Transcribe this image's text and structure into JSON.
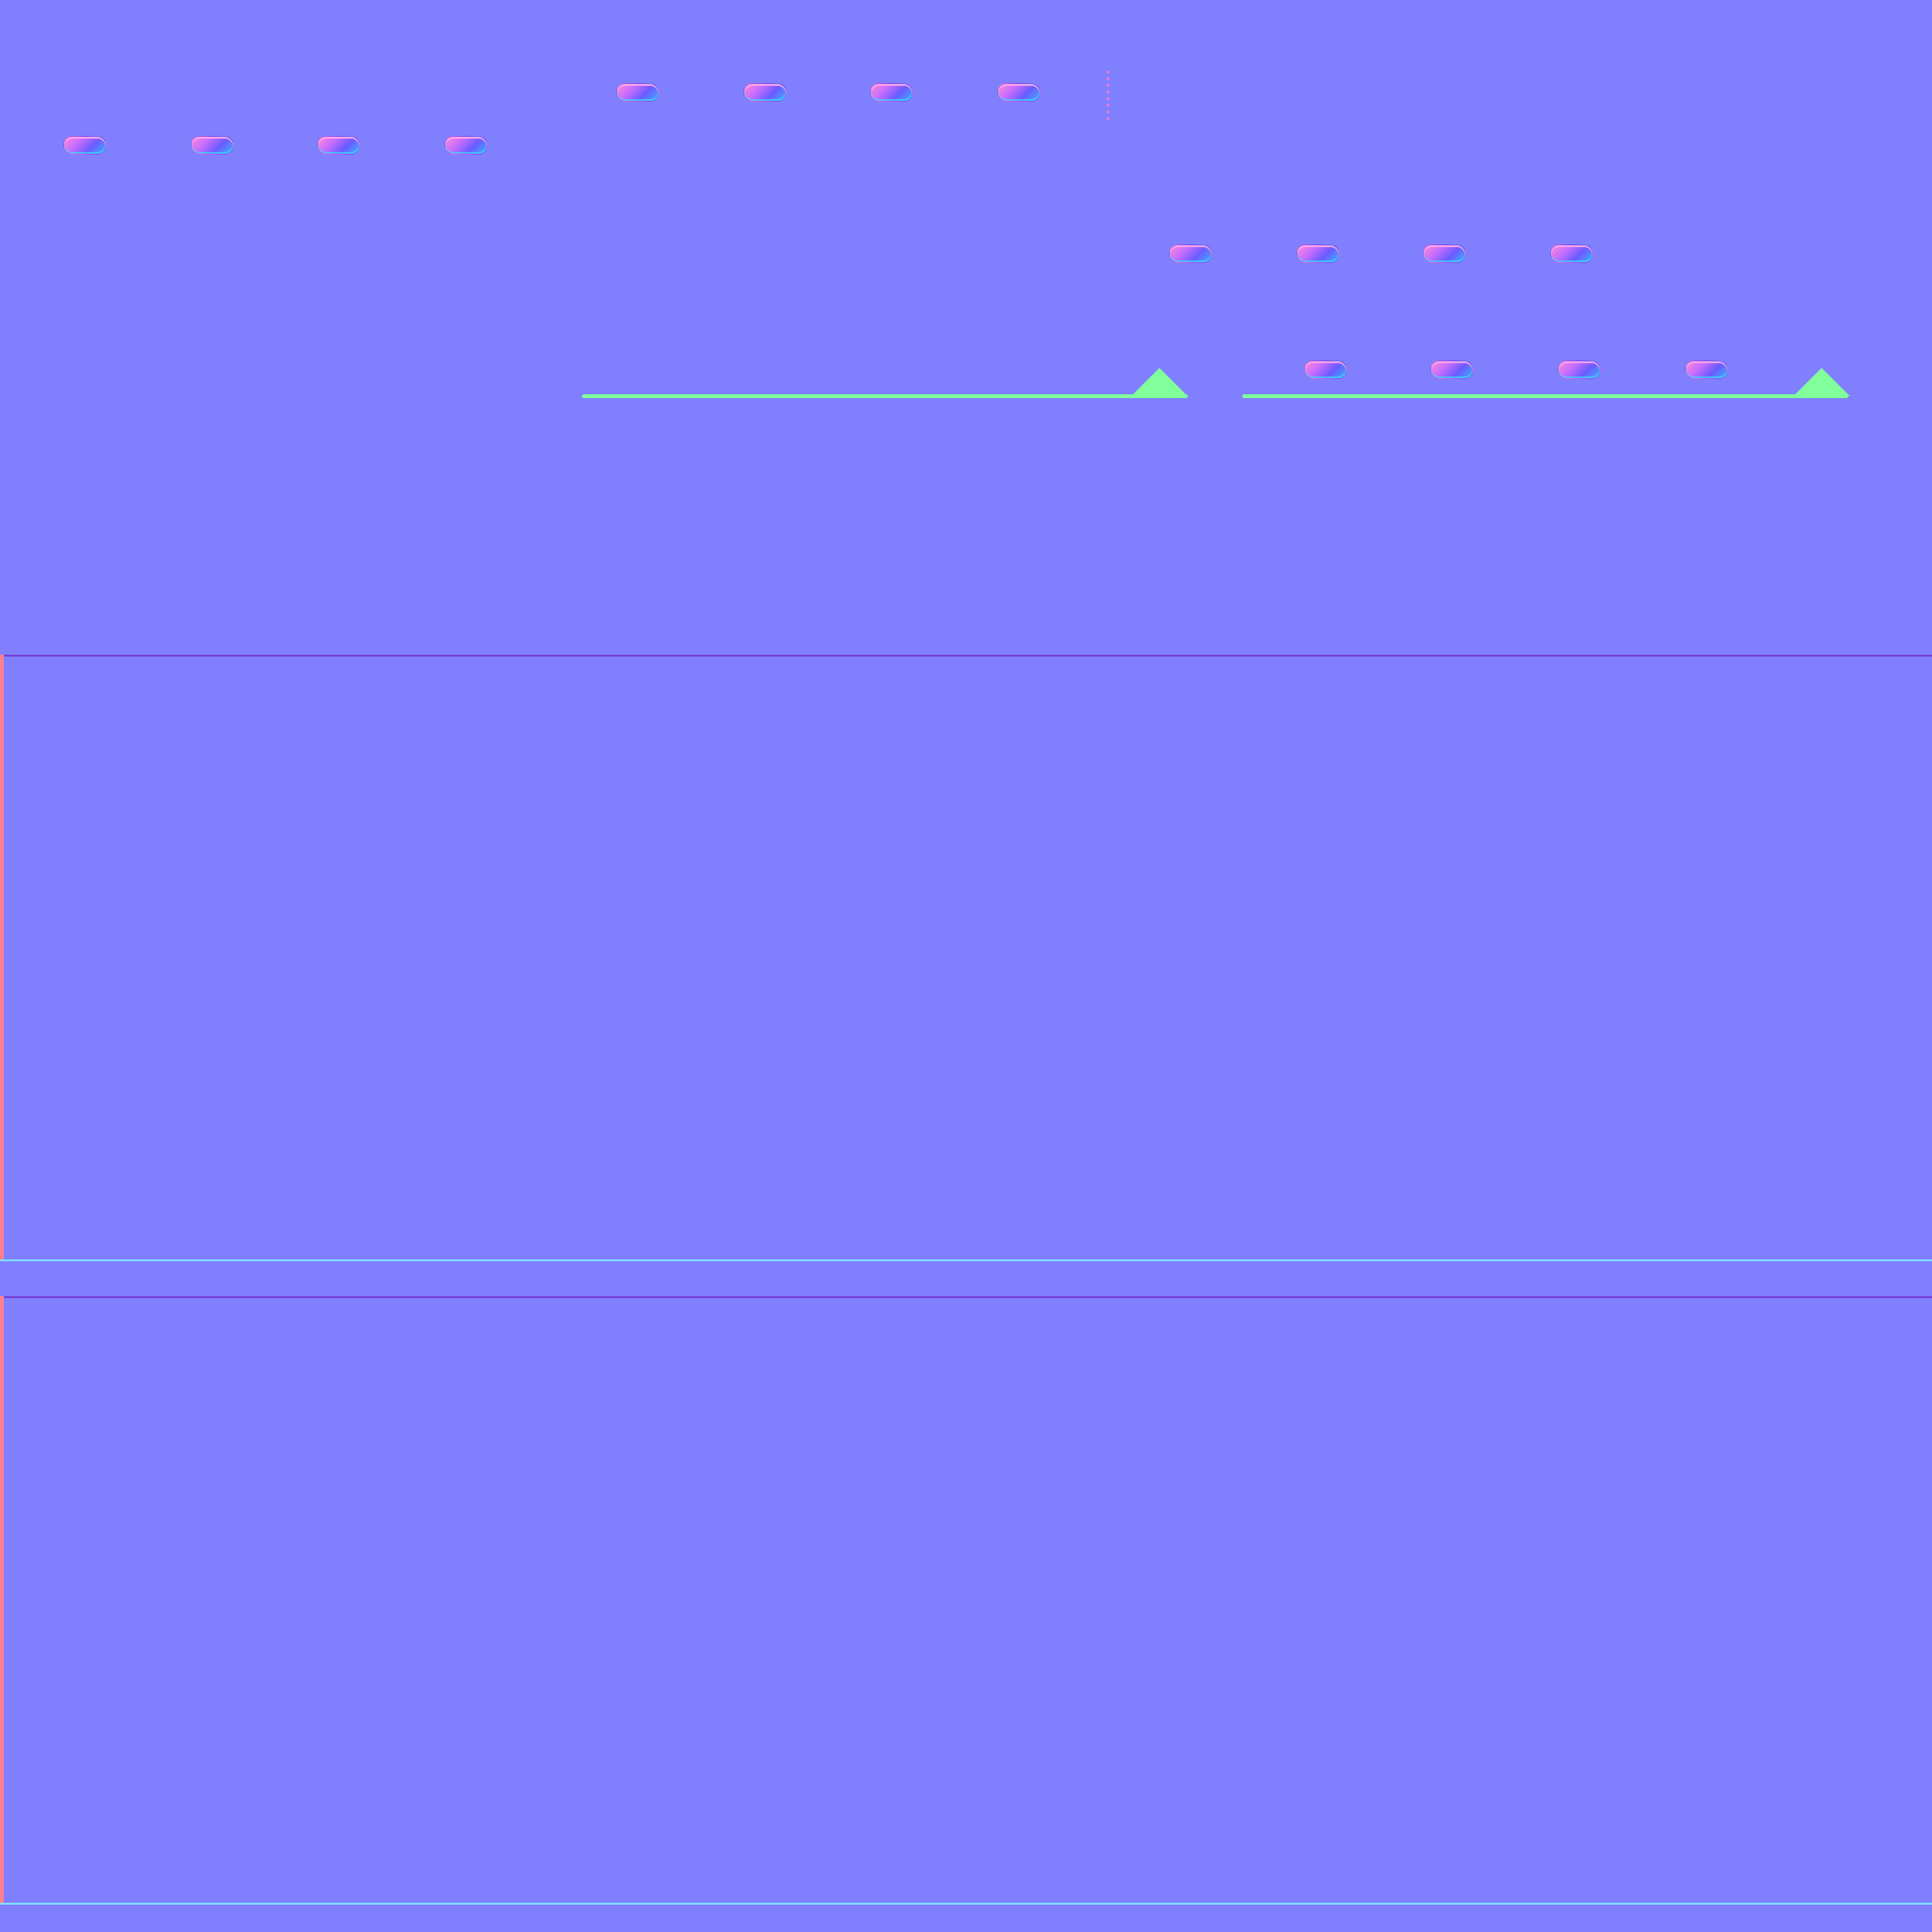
{
  "texture": {
    "base_color": "#8080ff",
    "accent_colors": {
      "edge_top": "#7a40d8",
      "edge_left": "#ff8090",
      "edge_bottom": "#80dcff",
      "rail": "#80ff9a",
      "bump_highlight": "#ff8ad6",
      "bump_shadow": "#3fb0ff"
    }
  }
}
